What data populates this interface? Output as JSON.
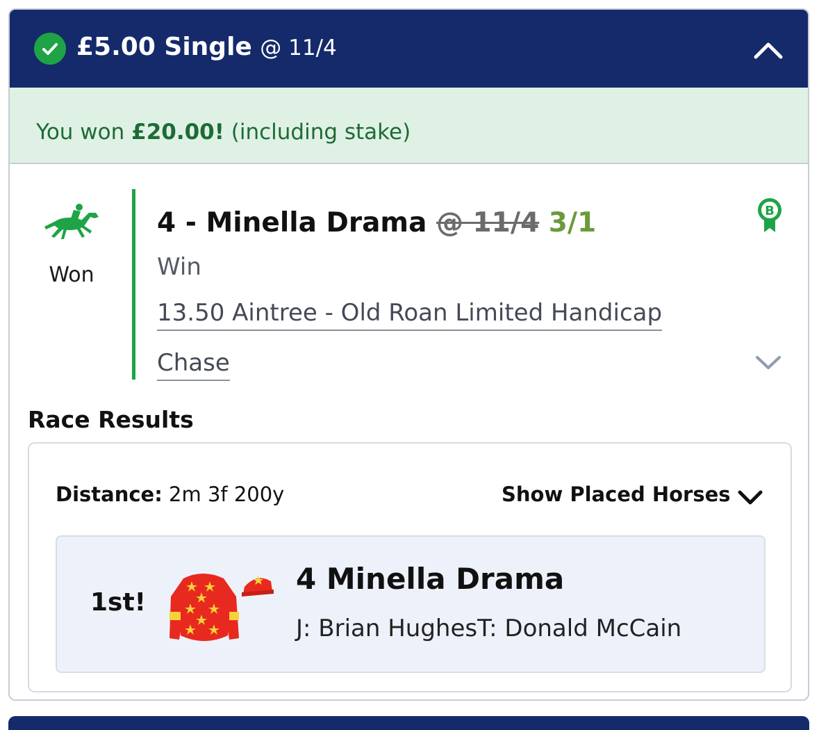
{
  "bet": {
    "stake": "£5.00 Single",
    "odds": "@ 11/4",
    "status_icon": "check-circle-icon",
    "collapse_icon": "chevron-up-icon"
  },
  "win_banner": {
    "prefix": "You won",
    "amount": "£20.00!",
    "suffix": "(including stake)"
  },
  "selection": {
    "status": "Won",
    "status_icon": "racehorse-icon",
    "title": "4 - Minella Drama",
    "original_odds": "@ 11/4",
    "boosted_odds": "3/1",
    "boost_badge_letter": "B",
    "market": "Win",
    "race_line1": "13.50 Aintree - Old Roan Limited Handicap",
    "race_line2": "Chase",
    "expand_icon": "chevron-down-icon"
  },
  "race_results": {
    "heading": "Race Results",
    "distance_label": "Distance:",
    "distance_value": "2m 3f 200y",
    "show_placed_label": "Show Placed Horses",
    "runners": [
      {
        "position": "1st!",
        "name": "4 Minella Drama",
        "connections": "J: Brian HughesT: Donald McCain",
        "silks_icon": "jockey-silks-icon"
      }
    ]
  },
  "colors": {
    "header_bg": "#142a6a",
    "win_green": "#1ea446",
    "banner_bg": "#dff1e5",
    "boosted_odds": "#6b9a3b"
  }
}
